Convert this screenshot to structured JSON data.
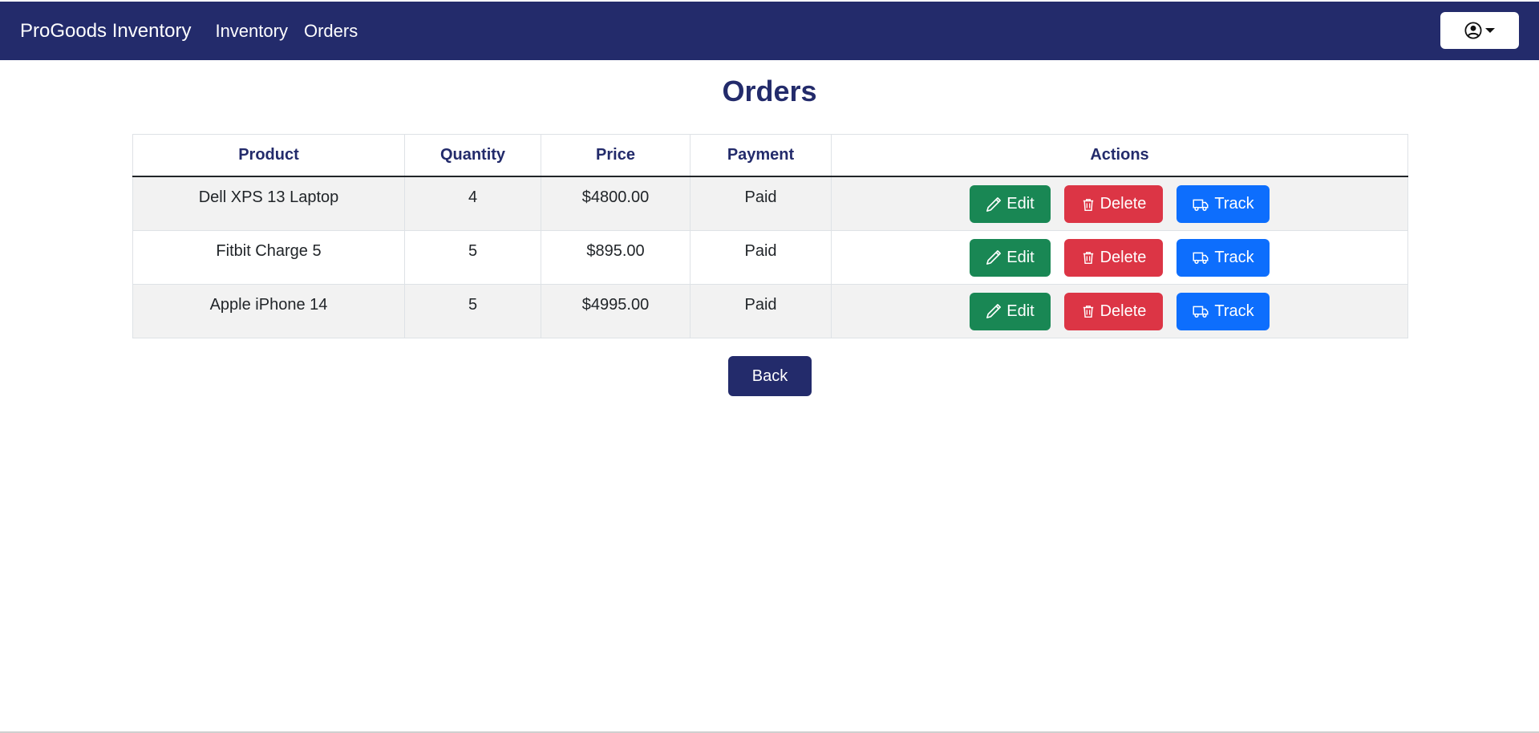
{
  "navbar": {
    "brand": "ProGoods Inventory",
    "links": [
      "Inventory",
      "Orders"
    ],
    "user_menu_icon": "user-circle-icon"
  },
  "page": {
    "title": "Orders",
    "back_label": "Back"
  },
  "table": {
    "headers": [
      "Product",
      "Quantity",
      "Price",
      "Payment",
      "Actions"
    ],
    "rows": [
      [
        "Dell XPS 13 Laptop",
        "4",
        "$4800.00",
        "Paid"
      ],
      [
        "Fitbit Charge 5",
        "5",
        "$895.00",
        "Paid"
      ],
      [
        "Apple iPhone 14",
        "5",
        "$4995.00",
        "Paid"
      ]
    ],
    "actions": {
      "edit": "Edit",
      "delete": "Delete",
      "track": "Track"
    }
  },
  "colors": {
    "navbar": "#232b6b",
    "edit": "#198754",
    "delete": "#dc3545",
    "track": "#0d6efd",
    "striped_row": "#f2f2f2"
  }
}
